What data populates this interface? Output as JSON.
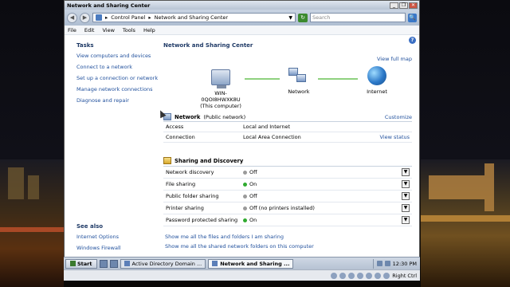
{
  "window": {
    "title": "Network and Sharing Center",
    "min_glyph": "_",
    "max_glyph": "❐",
    "close_glyph": "✕"
  },
  "address": {
    "back_glyph": "◀",
    "forward_glyph": "▶",
    "sep": "▸",
    "crumb1": "Control Panel",
    "crumb2": "Network and Sharing Center",
    "drop_glyph": "▼",
    "refresh_glyph": "↻",
    "search_placeholder": "Search",
    "search_glyph": "🔍"
  },
  "menu": [
    "File",
    "Edit",
    "View",
    "Tools",
    "Help"
  ],
  "help_glyph": "?",
  "tasks": {
    "heading": "Tasks",
    "items": [
      "View computers and devices",
      "Connect to a network",
      "Set up a connection or network",
      "Manage network connections",
      "Diagnose and repair"
    ]
  },
  "see_also": {
    "heading": "See also",
    "items": [
      "Internet Options",
      "Windows Firewall"
    ]
  },
  "main": {
    "heading": "Network and Sharing Center",
    "view_full_map": "View full map",
    "computer_name": "WIN-0QOI8HWXK8U",
    "computer_sub": "(This computer)",
    "network_label": "Network",
    "internet_label": "Internet"
  },
  "network": {
    "name": "Network",
    "type": "(Public network)",
    "customize": "Customize",
    "rows": [
      {
        "k": "Access",
        "v": "Local and Internet",
        "r": ""
      },
      {
        "k": "Connection",
        "v": "Local Area Connection",
        "r": "View status"
      }
    ]
  },
  "sharing": {
    "heading": "Sharing and Discovery",
    "expander_glyph": "▼",
    "rows": [
      {
        "k": "Network discovery",
        "v": "Off",
        "state": "off"
      },
      {
        "k": "File sharing",
        "v": "On",
        "state": "on"
      },
      {
        "k": "Public folder sharing",
        "v": "Off",
        "state": "off"
      },
      {
        "k": "Printer sharing",
        "v": "Off (no printers installed)",
        "state": "off"
      },
      {
        "k": "Password protected sharing",
        "v": "On",
        "state": "on"
      }
    ]
  },
  "bottom_links": [
    "Show me all the files and folders I am sharing",
    "Show me all the shared network folders on this computer"
  ],
  "taskbar": {
    "start": "Start",
    "tasks": [
      "Active Directory Domain ...",
      "Network and Sharing ..."
    ],
    "clock": "12:30 PM"
  },
  "statusbar": {
    "right_ctrl": "Right Ctrl"
  }
}
